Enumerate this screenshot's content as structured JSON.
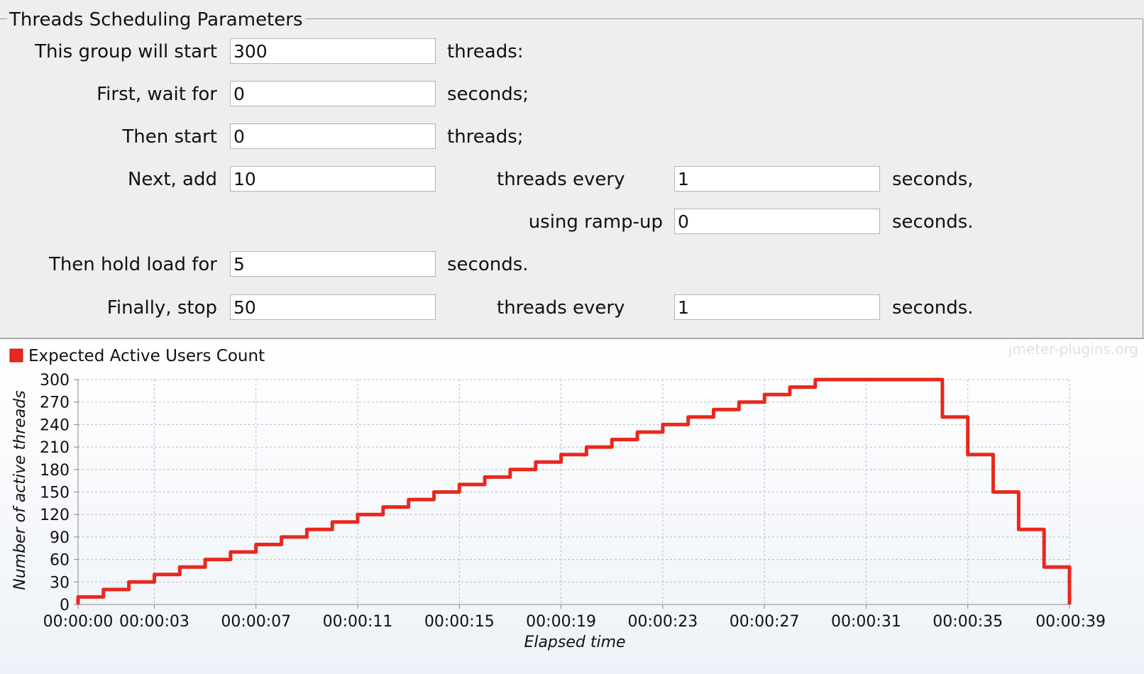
{
  "panel": {
    "title": "Threads Scheduling Parameters",
    "rows": {
      "start": {
        "label": "This group will start",
        "value": "300",
        "suffix": "threads:"
      },
      "wait": {
        "label": "First, wait for",
        "value": "0",
        "suffix": "seconds;"
      },
      "then_start": {
        "label": "Then start",
        "value": "0",
        "suffix": "threads;"
      },
      "next_add": {
        "label": "Next, add",
        "value": "10",
        "mid": "threads every",
        "value2": "1",
        "suffix": "seconds,"
      },
      "rampup": {
        "label": "using ramp-up",
        "value": "0",
        "suffix": "seconds."
      },
      "hold": {
        "label": "Then hold load for",
        "value": "5",
        "suffix": "seconds."
      },
      "stop": {
        "label": "Finally, stop",
        "value": "50",
        "mid": "threads every",
        "value2": "1",
        "suffix": "seconds."
      }
    }
  },
  "chart_data": {
    "type": "line",
    "legend": "Expected Active Users Count",
    "watermark": "jmeter-plugins.org",
    "xlabel": "Elapsed time",
    "ylabel": "Number of active threads",
    "ylim": [
      0,
      300
    ],
    "xlim": [
      0,
      39
    ],
    "yticks": [
      0,
      30,
      60,
      90,
      120,
      150,
      180,
      210,
      240,
      270,
      300
    ],
    "xticks": [
      {
        "t": 0,
        "label": "00:00:00"
      },
      {
        "t": 3,
        "label": "00:00:03"
      },
      {
        "t": 7,
        "label": "00:00:07"
      },
      {
        "t": 11,
        "label": "00:00:11"
      },
      {
        "t": 15,
        "label": "00:00:15"
      },
      {
        "t": 19,
        "label": "00:00:19"
      },
      {
        "t": 23,
        "label": "00:00:23"
      },
      {
        "t": 27,
        "label": "00:00:27"
      },
      {
        "t": 31,
        "label": "00:00:31"
      },
      {
        "t": 35,
        "label": "00:00:35"
      },
      {
        "t": 39,
        "label": "00:00:39"
      }
    ],
    "color": "#e8281e",
    "series": [
      {
        "name": "Expected Active Users Count",
        "points": [
          [
            0,
            0
          ],
          [
            0,
            10
          ],
          [
            1,
            10
          ],
          [
            1,
            20
          ],
          [
            2,
            20
          ],
          [
            2,
            30
          ],
          [
            3,
            30
          ],
          [
            3,
            40
          ],
          [
            4,
            40
          ],
          [
            4,
            50
          ],
          [
            5,
            50
          ],
          [
            5,
            60
          ],
          [
            6,
            60
          ],
          [
            6,
            70
          ],
          [
            7,
            70
          ],
          [
            7,
            80
          ],
          [
            8,
            80
          ],
          [
            8,
            90
          ],
          [
            9,
            90
          ],
          [
            9,
            100
          ],
          [
            10,
            100
          ],
          [
            10,
            110
          ],
          [
            11,
            110
          ],
          [
            11,
            120
          ],
          [
            12,
            120
          ],
          [
            12,
            130
          ],
          [
            13,
            130
          ],
          [
            13,
            140
          ],
          [
            14,
            140
          ],
          [
            14,
            150
          ],
          [
            15,
            150
          ],
          [
            15,
            160
          ],
          [
            16,
            160
          ],
          [
            16,
            170
          ],
          [
            17,
            170
          ],
          [
            17,
            180
          ],
          [
            18,
            180
          ],
          [
            18,
            190
          ],
          [
            19,
            190
          ],
          [
            19,
            200
          ],
          [
            20,
            200
          ],
          [
            20,
            210
          ],
          [
            21,
            210
          ],
          [
            21,
            220
          ],
          [
            22,
            220
          ],
          [
            22,
            230
          ],
          [
            23,
            230
          ],
          [
            23,
            240
          ],
          [
            24,
            240
          ],
          [
            24,
            250
          ],
          [
            25,
            250
          ],
          [
            25,
            260
          ],
          [
            26,
            260
          ],
          [
            26,
            270
          ],
          [
            27,
            270
          ],
          [
            27,
            280
          ],
          [
            28,
            280
          ],
          [
            28,
            290
          ],
          [
            29,
            290
          ],
          [
            29,
            300
          ],
          [
            34,
            300
          ],
          [
            34,
            250
          ],
          [
            35,
            250
          ],
          [
            35,
            200
          ],
          [
            36,
            200
          ],
          [
            36,
            150
          ],
          [
            37,
            150
          ],
          [
            37,
            100
          ],
          [
            38,
            100
          ],
          [
            38,
            50
          ],
          [
            39,
            50
          ],
          [
            39,
            0
          ]
        ]
      }
    ]
  }
}
